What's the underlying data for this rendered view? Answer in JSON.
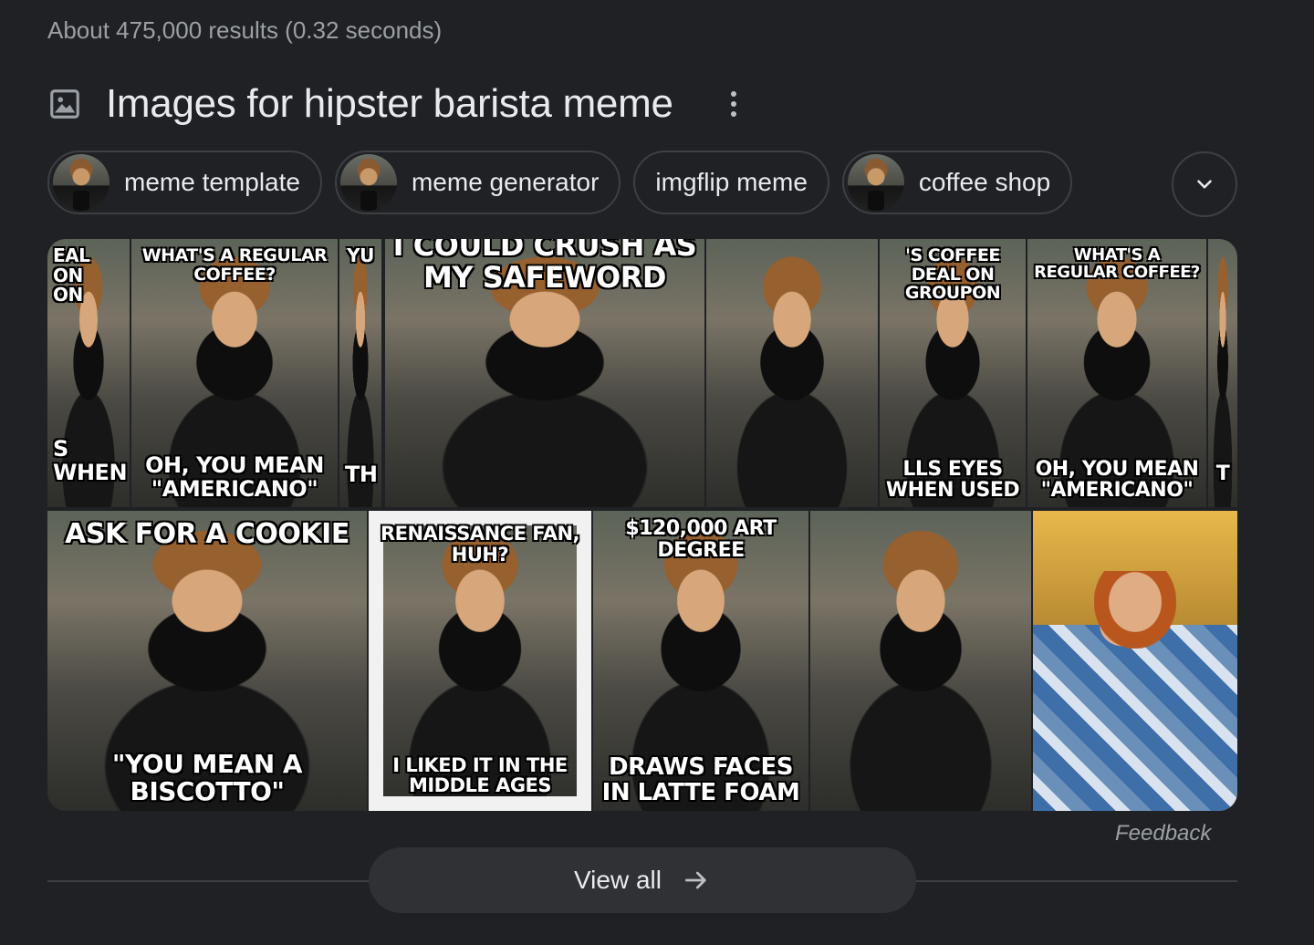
{
  "result_stats": "About 475,000 results (0.32 seconds)",
  "images_header": {
    "title": "Images for hipster barista meme",
    "icon": "image-icon",
    "menu_icon": "more-vert-icon"
  },
  "chips": [
    {
      "label": "meme template",
      "has_thumb": true
    },
    {
      "label": "meme generator",
      "has_thumb": true
    },
    {
      "label": "imgflip meme",
      "has_thumb": false
    },
    {
      "label": "coffee shop",
      "has_thumb": true
    }
  ],
  "expand_icon": "chevron-down-icon",
  "images": [
    {
      "name": "result-image-1-a",
      "top": "EAL ON\nON",
      "bottom": "S WHEN"
    },
    {
      "name": "result-image-1-b",
      "top": "WHAT'S A REGULAR COFFEE?",
      "bottom": "OH, YOU MEAN \"AMERICANO\""
    },
    {
      "name": "result-image-1-c",
      "top": "YU",
      "bottom": "TH"
    },
    {
      "name": "result-image-2",
      "top": "I COULD CRUSH AS MY SAFEWORD",
      "bottom": ""
    },
    {
      "name": "result-image-3",
      "top": "",
      "bottom": ""
    },
    {
      "name": "result-image-4",
      "top": "'S COFFEE DEAL ON GROUPON",
      "bottom": "LLS EYES WHEN USED"
    },
    {
      "name": "result-image-5-a",
      "top": "WHAT'S A REGULAR COFFEE?",
      "bottom": "OH, YOU MEAN \"AMERICANO\""
    },
    {
      "name": "result-image-5-b",
      "top": "",
      "bottom": "T"
    },
    {
      "name": "result-image-6",
      "top": "ASK FOR A COOKIE",
      "bottom": "\"YOU MEAN A BISCOTTO\""
    },
    {
      "name": "result-image-7",
      "top": "RENAISSANCE FAN, HUH?",
      "bottom": "I LIKED IT IN THE MIDDLE AGES"
    },
    {
      "name": "result-image-8",
      "top": "$120,000 ART DEGREE",
      "bottom": "DRAWS FACES IN LATTE FOAM"
    },
    {
      "name": "result-image-9",
      "top": "",
      "bottom": ""
    },
    {
      "name": "result-image-10",
      "top": "",
      "bottom": ""
    }
  ],
  "feedback": "Feedback",
  "view_all": {
    "label": "View all",
    "icon": "arrow-right-icon"
  },
  "colors": {
    "background": "#202124",
    "text": "#e8eaed",
    "muted": "#9aa0a6",
    "border": "#3c4043",
    "button": "#303134"
  }
}
